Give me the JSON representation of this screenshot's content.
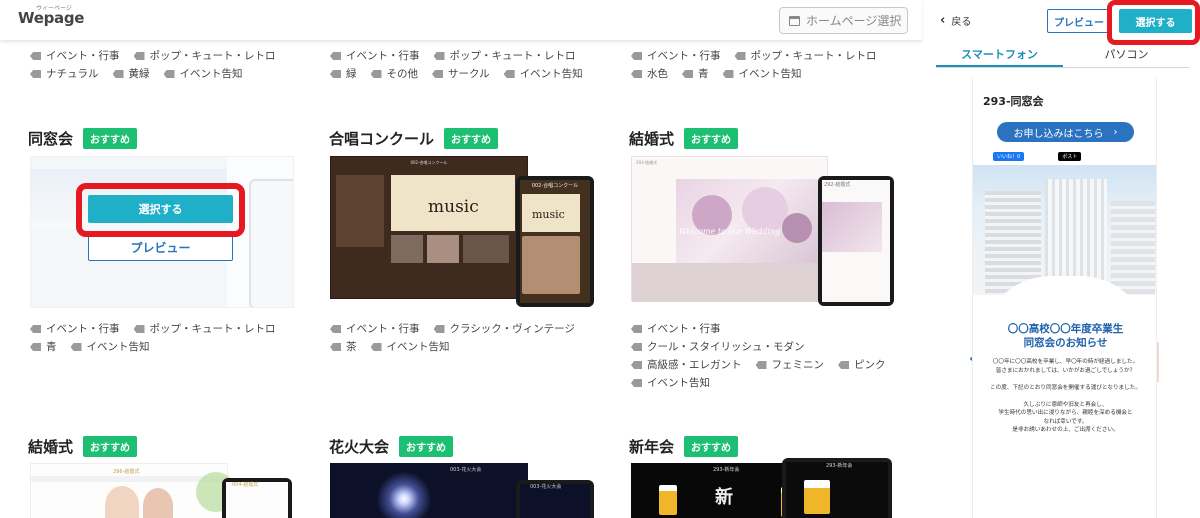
{
  "header": {
    "logo": "Wepage",
    "logo_ruby": "ウィーページ",
    "homepage_select": "ホームページ選択"
  },
  "top_tags": [
    [
      "イベント・行事",
      "ポップ・キュート・レトロ",
      "ナチュラル",
      "黄緑",
      "イベント告知"
    ],
    [
      "イベント・行事",
      "ポップ・キュート・レトロ",
      "緑",
      "その他",
      "サークル",
      "イベント告知"
    ],
    [
      "イベント・行事",
      "ポップ・キュート・レトロ",
      "水色",
      "青",
      "イベント告知"
    ]
  ],
  "badge_label": "おすすめ",
  "cards": [
    {
      "title": "同窓会",
      "tags": [
        "イベント・行事",
        "ポップ・キュート・レトロ",
        "青",
        "イベント告知"
      ]
    },
    {
      "title": "合唱コンクール",
      "tags": [
        "イベント・行事",
        "クラシック・ヴィンテージ",
        "茶",
        "イベント告知"
      ],
      "thumb_header": "002-合唱コンクール",
      "thumb_hero": "music",
      "tab_header": "002-合唱コンクール"
    },
    {
      "title": "結婚式",
      "tags": [
        "イベント・行事",
        "クール・スタイリッシュ・モダン",
        "高級感・エレガント",
        "フェミニン",
        "ピンク",
        "イベント告知"
      ],
      "thumb_header": "293-結婚式",
      "thumb_script": "Welcome to our Wedding",
      "tab_header": "292-結婚式"
    }
  ],
  "row3": [
    {
      "title": "結婚式",
      "thumb_header": "296-結婚式",
      "tab_header": "004-結婚式"
    },
    {
      "title": "花火大会",
      "thumb_header": "003-花火大会",
      "tab_header": "003-花火大会"
    },
    {
      "title": "新年会",
      "thumb_header": "293-新年会",
      "thumb_kanji": "新",
      "tab_header": "293-新年会"
    }
  ],
  "overlay": {
    "select_label": "選択する",
    "preview_label": "プレビュー"
  },
  "right_panel": {
    "back_label": "戻る",
    "preview_label": "プレビュー",
    "select_label": "選択する",
    "tabs": [
      "スマートフォン",
      "パソコン"
    ],
    "screen": {
      "title": "293-同窓会",
      "apply_label": "お申し込みはこちら",
      "like_label": "いいね！0",
      "post_label": "ポスト",
      "lead_line1": "〇〇高校〇〇年度卒業生",
      "lead_line2": "同窓会のお知らせ",
      "body": "〇〇年に〇〇高校を卒業し、早〇年の時が経過しました。\n皆さまにおかれましては、いかがお過ごしでしょうか？\n\nこの度、下記のとおり同窓会を開催する運びとなりました。\n\n久しぶりに恩師や旧友と再会し、\n学生時代の思い出に浸りながら、親睦を深める機会と\nなれば幸いです。\n是非お誘いあわせの上、ご出席ください。"
    }
  },
  "colors": {
    "accent": "#1fb0c8",
    "badge": "#1dbf73",
    "link": "#2b72c0",
    "highlight": "#e5191f"
  }
}
